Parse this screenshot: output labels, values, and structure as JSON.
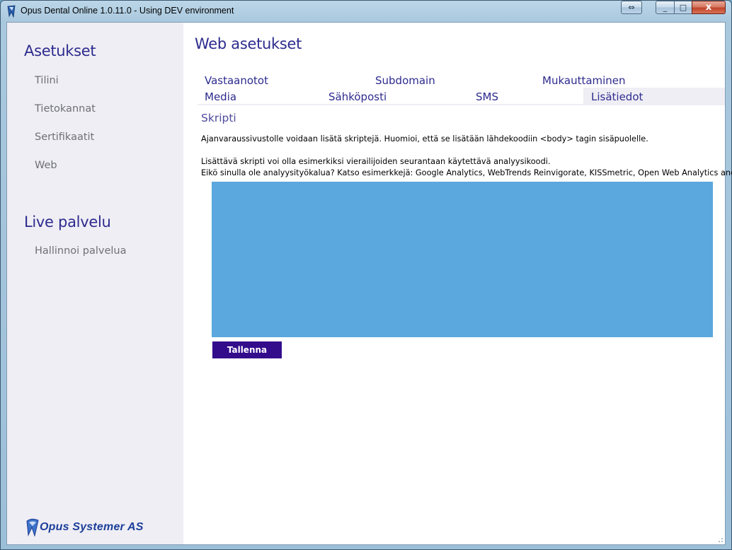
{
  "window": {
    "title": "Opus Dental Online 1.0.11.0 - Using DEV environment",
    "close_glyph": "x",
    "minimize_glyph": "_",
    "maximize_glyph": "□",
    "swap_glyph": "⇔"
  },
  "sidebar": {
    "settings_heading": "Asetukset",
    "settings_items": [
      {
        "label": "Tilini"
      },
      {
        "label": "Tietokannat"
      },
      {
        "label": "Sertifikaatit"
      },
      {
        "label": "Web"
      }
    ],
    "live_heading": "Live palvelu",
    "live_items": [
      {
        "label": "Hallinnoi palvelua"
      }
    ],
    "brand_text": "Opus Systemer AS"
  },
  "main": {
    "title": "Web asetukset",
    "tabs_row1": [
      {
        "label": "Vastaanotot"
      },
      {
        "label": "Subdomain"
      },
      {
        "label": "Mukauttaminen"
      }
    ],
    "tabs_row2": [
      {
        "label": "Media"
      },
      {
        "label": "Sähköposti"
      },
      {
        "label": "SMS"
      },
      {
        "label": "Lisätiedot",
        "active": true
      }
    ],
    "section_title": "Skripti",
    "desc_line1": "Ajanvaraussivustolle voidaan lisätä skriptejä. Huomioi, että se lisätään lähdekoodiin <body> tagin sisäpuolelle.",
    "desc_line2": "Lisättävä skripti voi olla esimerkiksi vierailijoiden seurantaan käytettävä analyysikoodi.",
    "desc_line3": "Eikö sinulla ole analyysityökalua? Katso esimerkkejä: Google Analytics, WebTrends Reinvigorate, KISSmetric, Open Web Analytics and Clicky",
    "script_value": "",
    "save_label": "Tallenna"
  },
  "colors": {
    "accent": "#2d2b8e",
    "sidebar_bg": "#efeef4",
    "script_area_bg": "#5aa8dd",
    "save_button_bg": "#330c8c"
  }
}
